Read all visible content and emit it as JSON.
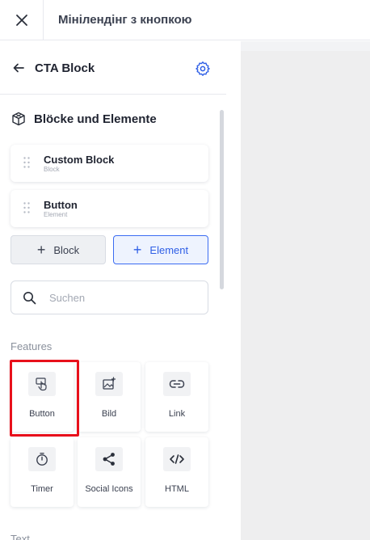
{
  "topbar": {
    "title": "Мінілендінг з кнопкою"
  },
  "panel": {
    "title": "CTA Block"
  },
  "section": {
    "title": "Blöcke und Elemente"
  },
  "tree": [
    {
      "name": "Custom Block",
      "type": "Block"
    },
    {
      "name": "Button",
      "type": "Element"
    }
  ],
  "buttons": {
    "add_block": "Block",
    "add_element": "Element"
  },
  "search": {
    "placeholder": "Suchen",
    "value": ""
  },
  "groups": {
    "features": "Features",
    "text": "Text"
  },
  "features": [
    {
      "label": "Button",
      "icon": "hand-pointer-icon"
    },
    {
      "label": "Bild",
      "icon": "image-add-icon"
    },
    {
      "label": "Link",
      "icon": "link-icon"
    },
    {
      "label": "Timer",
      "icon": "timer-icon"
    },
    {
      "label": "Social Icons",
      "icon": "share-icon"
    },
    {
      "label": "HTML",
      "icon": "code-icon"
    }
  ],
  "colors": {
    "accent": "#2f5fe6",
    "highlight": "#e8101b",
    "canvas": "#eeeeef"
  }
}
